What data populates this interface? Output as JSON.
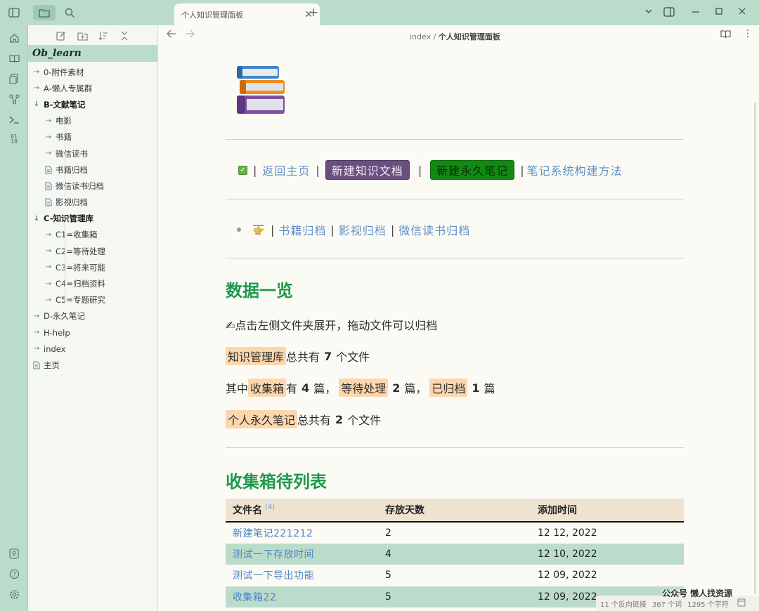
{
  "app": {
    "tab_title": "个人知识管理面板",
    "vault_name": "Ob_learn",
    "breadcrumb_parent": "index",
    "breadcrumb_separator": "/",
    "breadcrumb_current": "个人知识管理面板"
  },
  "sidebar": {
    "items": [
      {
        "label": "0-附件素材",
        "level": 0,
        "type": "folder",
        "open": false
      },
      {
        "label": "A-懒人专属群",
        "level": 0,
        "type": "folder",
        "open": false
      },
      {
        "label": "B-文献笔记",
        "level": 0,
        "type": "folder",
        "open": true
      },
      {
        "label": "电影",
        "level": 1,
        "type": "folder",
        "open": false
      },
      {
        "label": "书籍",
        "level": 1,
        "type": "folder",
        "open": false
      },
      {
        "label": "微信读书",
        "level": 1,
        "type": "folder",
        "open": false
      },
      {
        "label": "书籍归档",
        "level": 1,
        "type": "file"
      },
      {
        "label": "微信读书归档",
        "level": 1,
        "type": "file"
      },
      {
        "label": "影视归档",
        "level": 1,
        "type": "file"
      },
      {
        "label": "C-知识管理库",
        "level": 0,
        "type": "folder",
        "open": true
      },
      {
        "label": "C1=收集箱",
        "level": 1,
        "type": "folder",
        "open": false
      },
      {
        "label": "C2=等待处理",
        "level": 1,
        "type": "folder",
        "open": false
      },
      {
        "label": "C3=将来可能",
        "level": 1,
        "type": "folder",
        "open": false
      },
      {
        "label": "C4=归档资料",
        "level": 1,
        "type": "folder",
        "open": false
      },
      {
        "label": "C5=专题研究",
        "level": 1,
        "type": "folder",
        "open": false
      },
      {
        "label": "D-永久笔记",
        "level": 0,
        "type": "folder",
        "open": false
      },
      {
        "label": "H-help",
        "level": 0,
        "type": "folder",
        "open": false
      },
      {
        "label": "index",
        "level": 0,
        "type": "folder",
        "open": false
      },
      {
        "label": "主页",
        "level": 0,
        "type": "file"
      }
    ]
  },
  "content": {
    "links": {
      "back_home": "返回主页",
      "new_knowledge": "新建知识文档",
      "new_permanent": "新建永久笔记",
      "method": "笔记系统构建方法",
      "sep": "|"
    },
    "archive_links": {
      "books": "书籍归档",
      "video": "影视归档",
      "wechat": "微信读书归档"
    },
    "section1_title": "数据一览",
    "tip": "✍点击左侧文件夹展开，拖动文件可以归档",
    "stat1": {
      "tag": "知识管理库",
      "pre": "总共有",
      "num": "7",
      "post": "个文件"
    },
    "stat2": {
      "lead": "其中",
      "tag1": "收集箱",
      "p1": "有",
      "n1": "4",
      "u1": "篇，",
      "tag2": "等待处理",
      "n2": "2",
      "u2": "篇，",
      "tag3": "已归档",
      "n3": "1",
      "u3": "篇"
    },
    "stat3": {
      "tag": "个人永久笔记",
      "pre": "总共有",
      "num": "2",
      "post": "个文件"
    },
    "section2_title": "收集箱待列表",
    "table": {
      "headers": [
        "文件名",
        "存放天数",
        "添加时间"
      ],
      "count": "(4)",
      "rows": [
        [
          "新建笔记221212",
          "2",
          "12 12, 2022"
        ],
        [
          "测试一下存放时间",
          "4",
          "12 10, 2022"
        ],
        [
          "测试一下导出功能",
          "5",
          "12 09, 2022"
        ],
        [
          "收集箱22",
          "5",
          "12 09, 2022"
        ]
      ]
    }
  },
  "statusbar": {
    "backlinks": "11 个反向链接",
    "words": "367 个词",
    "chars": "1295 个字符"
  },
  "watermark": "公众号 懒人找资源"
}
